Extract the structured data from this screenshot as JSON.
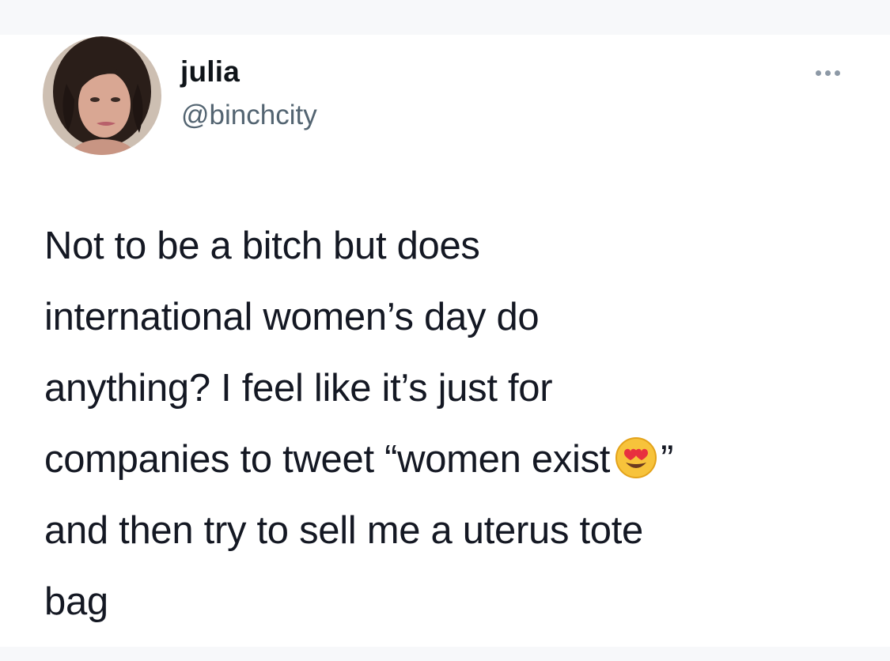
{
  "tweet": {
    "author": {
      "display_name": "julia",
      "handle": "@binchcity",
      "avatar_icon": "profile-photo"
    },
    "more_icon": "ellipsis-icon",
    "text_lines": [
      "Not to be a bitch but does",
      "international women’s day do",
      "anything? I feel like it’s just for",
      "companies to tweet “women exist",
      "and then try to sell me a uterus tote",
      "bag"
    ],
    "line4_suffix": "”",
    "emoji": "heart-eyes-emoji"
  },
  "colors": {
    "background": "#ffffff",
    "text": "#141823",
    "secondary_text": "#536471",
    "strip": "#f7f8fa"
  }
}
